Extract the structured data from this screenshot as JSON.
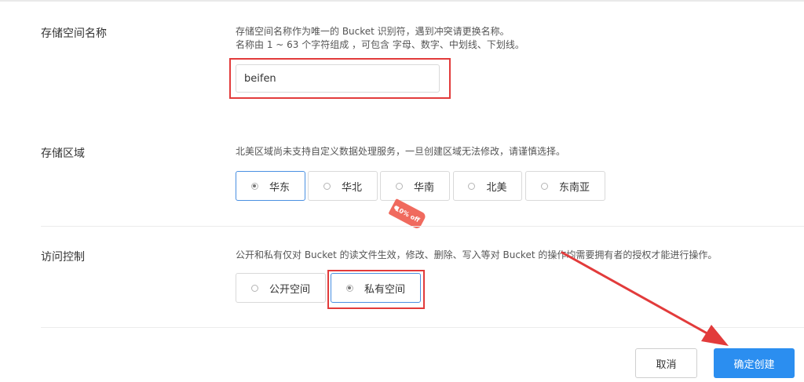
{
  "bucket_name": {
    "label": "存储空间名称",
    "desc_line1": "存储空间名称作为唯一的 Bucket 识别符，遇到冲突请更换名称。",
    "desc_line2": "名称由 1 ~ 63 个字符组成 ，可包含 字母、数字、中划线、下划线。",
    "value": "beifen"
  },
  "region": {
    "label": "存储区域",
    "desc": "北美区域尚未支持自定义数据处理服务，一旦创建区域无法修改，请谨慎选择。",
    "options": [
      "华东",
      "华北",
      "华南",
      "北美",
      "东南亚"
    ],
    "selected": "华东",
    "discount_tag": "10% off"
  },
  "access": {
    "label": "访问控制",
    "desc": "公开和私有仅对 Bucket 的读文件生效，修改、删除、写入等对 Bucket 的操作均需要拥有者的授权才能进行操作。",
    "options": [
      "公开空间",
      "私有空间"
    ],
    "selected": "私有空间"
  },
  "actions": {
    "cancel": "取消",
    "create": "确定创建"
  },
  "colors": {
    "primary": "#2b8ef0",
    "annotation_red": "#e23b3b",
    "selected_border": "#4a90e2",
    "tag": "#f06a5e"
  }
}
